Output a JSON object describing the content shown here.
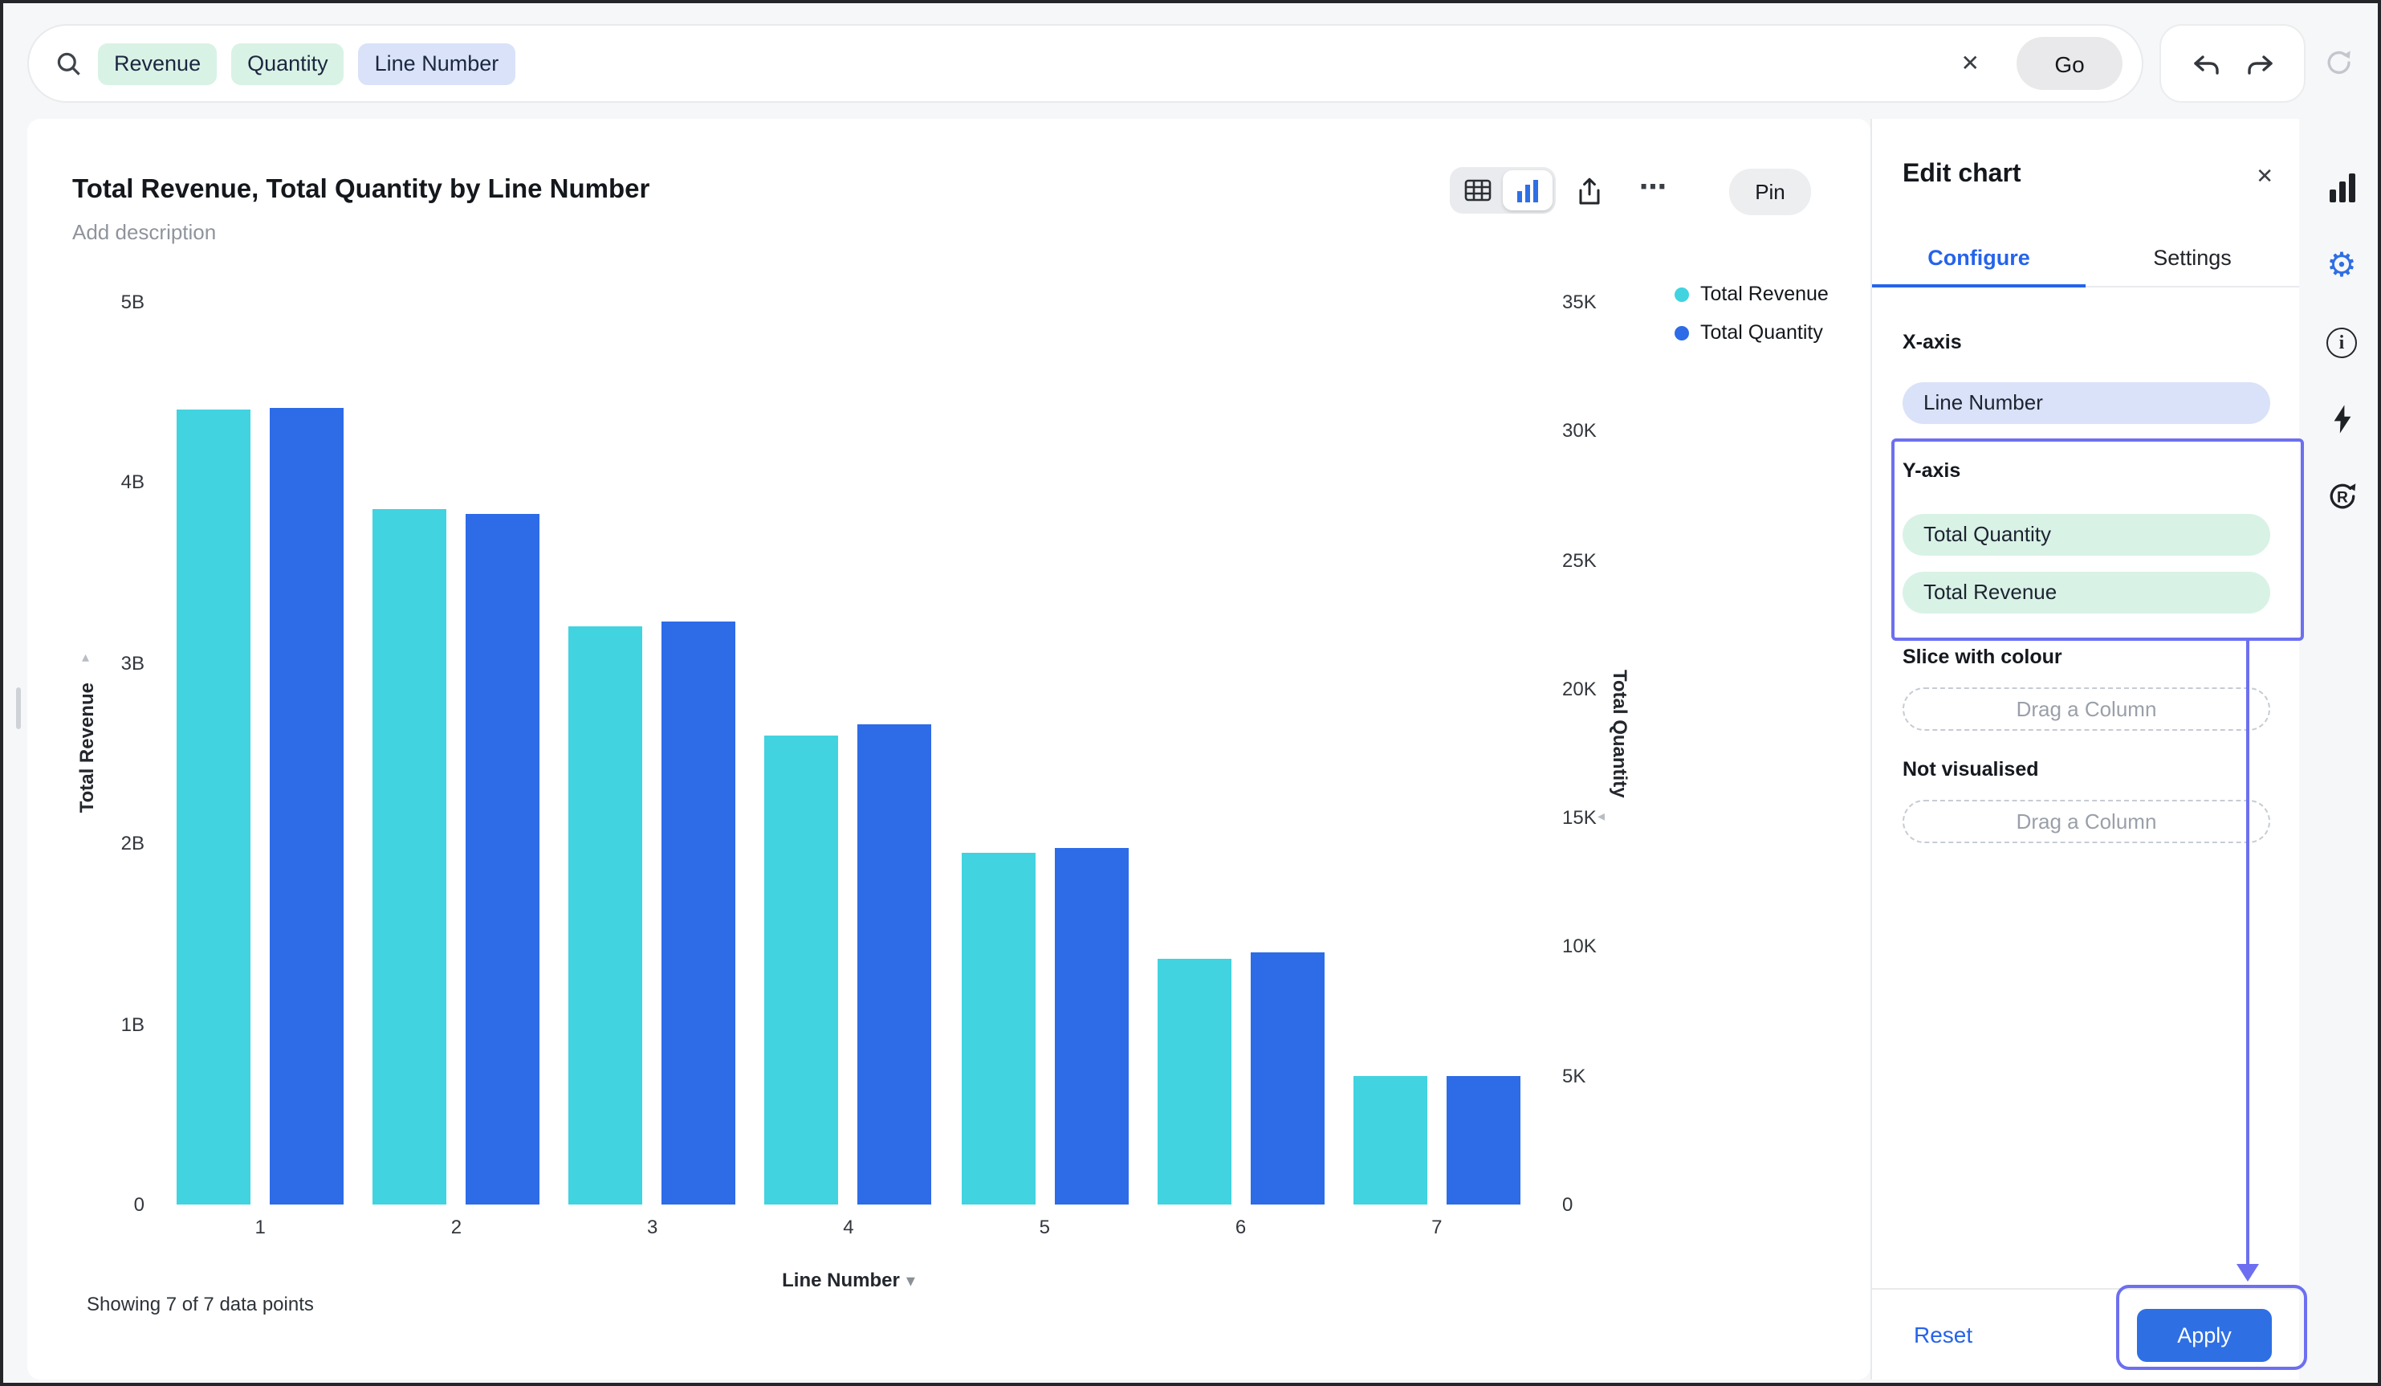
{
  "topbar": {
    "tokens": [
      "Revenue",
      "Quantity",
      "Line Number"
    ],
    "go_label": "Go"
  },
  "chart_header": {
    "title": "Total Revenue, Total Quantity by Line Number",
    "description_placeholder": "Add description",
    "pin_label": "Pin"
  },
  "legend": [
    {
      "label": "Total Revenue",
      "color": "#41d3e0"
    },
    {
      "label": "Total Quantity",
      "color": "#2d6be7"
    }
  ],
  "chart_data": {
    "type": "bar",
    "title": "Total Revenue, Total Quantity by Line Number",
    "categories": [
      "1",
      "2",
      "3",
      "4",
      "5",
      "6",
      "7"
    ],
    "series": [
      {
        "name": "Total Revenue",
        "axis": "left",
        "color": "#41d3e0",
        "unit": "B",
        "values_billions": [
          4.4,
          3.85,
          3.2,
          2.6,
          1.95,
          1.36,
          0.71
        ]
      },
      {
        "name": "Total Quantity",
        "axis": "right",
        "color": "#2d6be7",
        "unit": "K",
        "values_thousands": [
          30.9,
          26.8,
          22.6,
          18.6,
          13.8,
          9.8,
          5.0
        ]
      }
    ],
    "xlabel": "Line Number",
    "left_axis": {
      "label": "Total Revenue",
      "ticks": [
        "0",
        "1B",
        "2B",
        "3B",
        "4B",
        "5B"
      ],
      "max_billions": 5
    },
    "right_axis": {
      "label": "Total Quantity",
      "ticks": [
        "0",
        "5K",
        "10K",
        "15K",
        "20K",
        "25K",
        "30K",
        "35K"
      ],
      "max_thousands": 35
    },
    "legend_position": "top-right",
    "grid": false
  },
  "footer": {
    "note": "Showing 7 of 7 data points"
  },
  "edit_panel": {
    "title": "Edit chart",
    "tabs": [
      "Configure",
      "Settings"
    ],
    "x_axis_label": "X-axis",
    "x_axis_value": "Line Number",
    "y_axis_label": "Y-axis",
    "y_axis_values": [
      "Total Quantity",
      "Total Revenue"
    ],
    "slice_label": "Slice with colour",
    "not_visualised_label": "Not visualised",
    "drop_placeholder": "Drag a Column",
    "reset_label": "Reset",
    "apply_label": "Apply"
  },
  "icons": {
    "close": "✕",
    "ellipsis": "⋯",
    "caret_down": "▾",
    "sort_up": "▴",
    "sort_left": "◂",
    "gear": "⚙",
    "info": "i"
  },
  "colors": {
    "accent_blue": "#2f6fe4",
    "bar_cyan": "#41d3e0",
    "bar_blue": "#2d6be7",
    "annotation_purple": "#6d6ff0",
    "pill_green": "#d9f2e6",
    "pill_lavender": "#d9e2f8",
    "background_gray": "#f6f7f8"
  }
}
